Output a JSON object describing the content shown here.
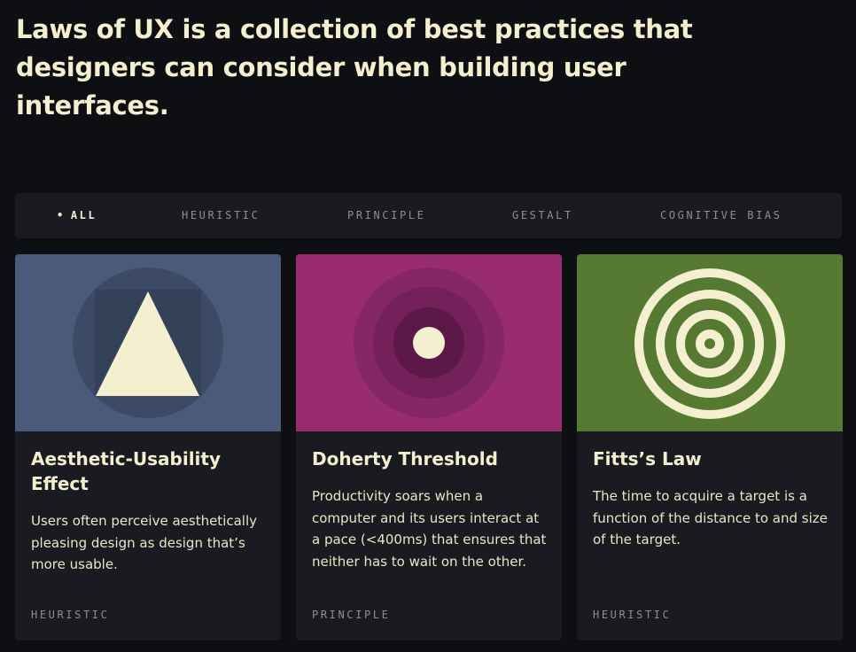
{
  "intro": "Laws of UX is a collection of best practices that designers can consider when building user interfaces.",
  "filters": [
    {
      "label": "ALL",
      "active": true
    },
    {
      "label": "HEURISTIC",
      "active": false
    },
    {
      "label": "PRINCIPLE",
      "active": false
    },
    {
      "label": "GESTALT",
      "active": false
    },
    {
      "label": "COGNITIVE BIAS",
      "active": false
    }
  ],
  "active_bullet": "•",
  "cards": [
    {
      "title": "Aesthetic-Usability Effect",
      "description": "Users often perceive aesthetically pleasing design as design that’s more usable.",
      "tag": "HEURISTIC",
      "color": "#4a5a7a",
      "icon": "triangle-icon"
    },
    {
      "title": "Doherty Threshold",
      "description": "Productivity soars when a computer and its users interact at a pace (<400ms) that ensures that neither has to wait on the other.",
      "tag": "PRINCIPLE",
      "color": "#982b72",
      "icon": "concentric-circles-icon"
    },
    {
      "title": "Fitts’s Law",
      "description": "The time to acquire a target is a function of the distance to and size of the target.",
      "tag": "HEURISTIC",
      "color": "#577a33",
      "icon": "target-icon"
    }
  ],
  "colors": {
    "background": "#0e0f13",
    "surface": "#1a1b20",
    "text": "#f3efcf",
    "muted": "#8c8d96"
  }
}
